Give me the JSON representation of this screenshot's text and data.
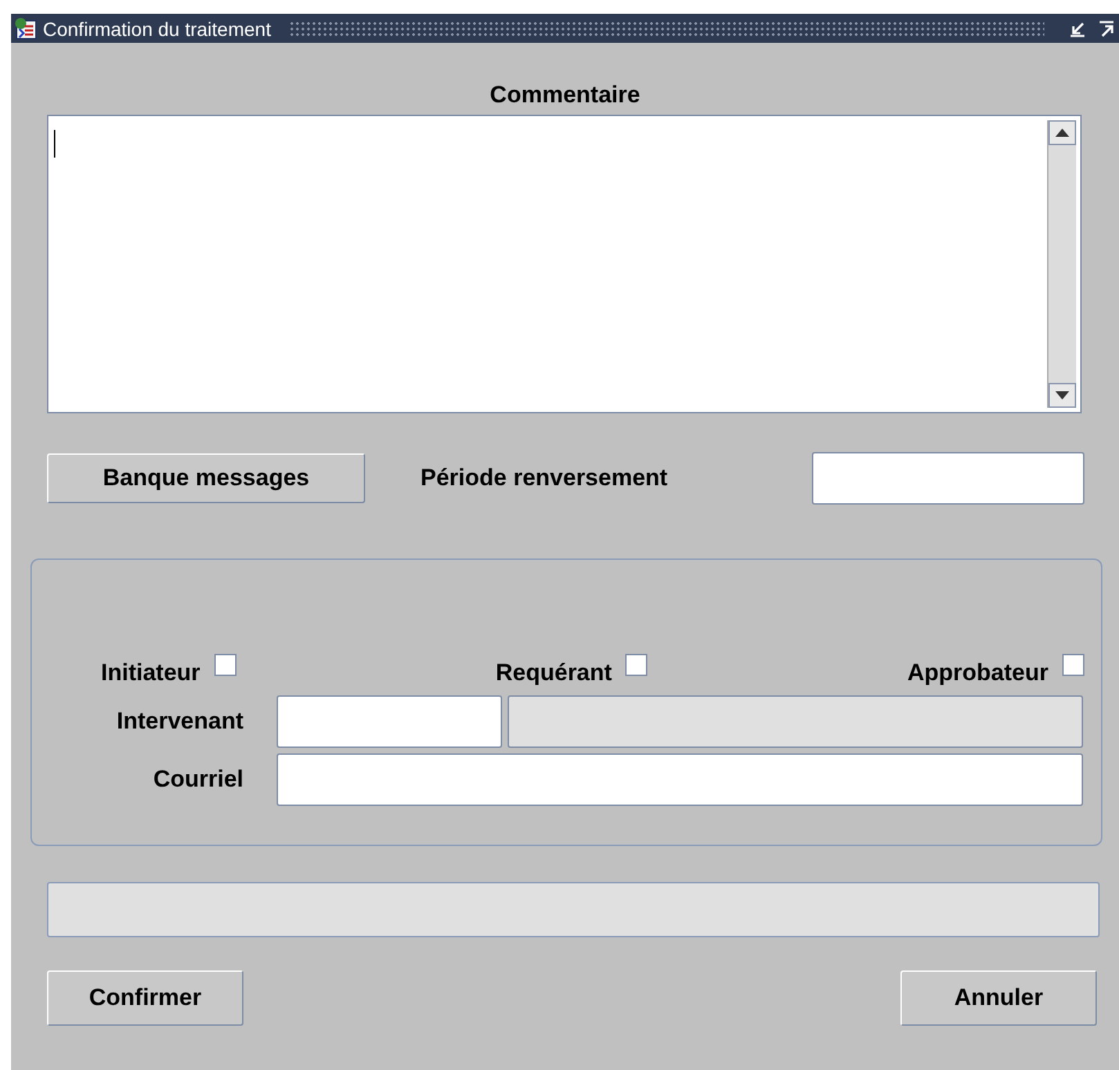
{
  "window": {
    "title": "Confirmation du traitement"
  },
  "comment": {
    "label": "Commentaire"
  },
  "messages_button": "Banque messages",
  "reversal_period": {
    "label": "Période renversement"
  },
  "roles": [
    {
      "label": "Initiateur",
      "checked": false
    },
    {
      "label": "Requérant",
      "checked": false
    },
    {
      "label": "Approbateur",
      "checked": false
    }
  ],
  "intervenant": {
    "label": "Intervenant"
  },
  "email": {
    "label": "Courriel"
  },
  "buttons": [
    {
      "label": "Confirmer"
    },
    {
      "label": "Annuler"
    }
  ]
}
